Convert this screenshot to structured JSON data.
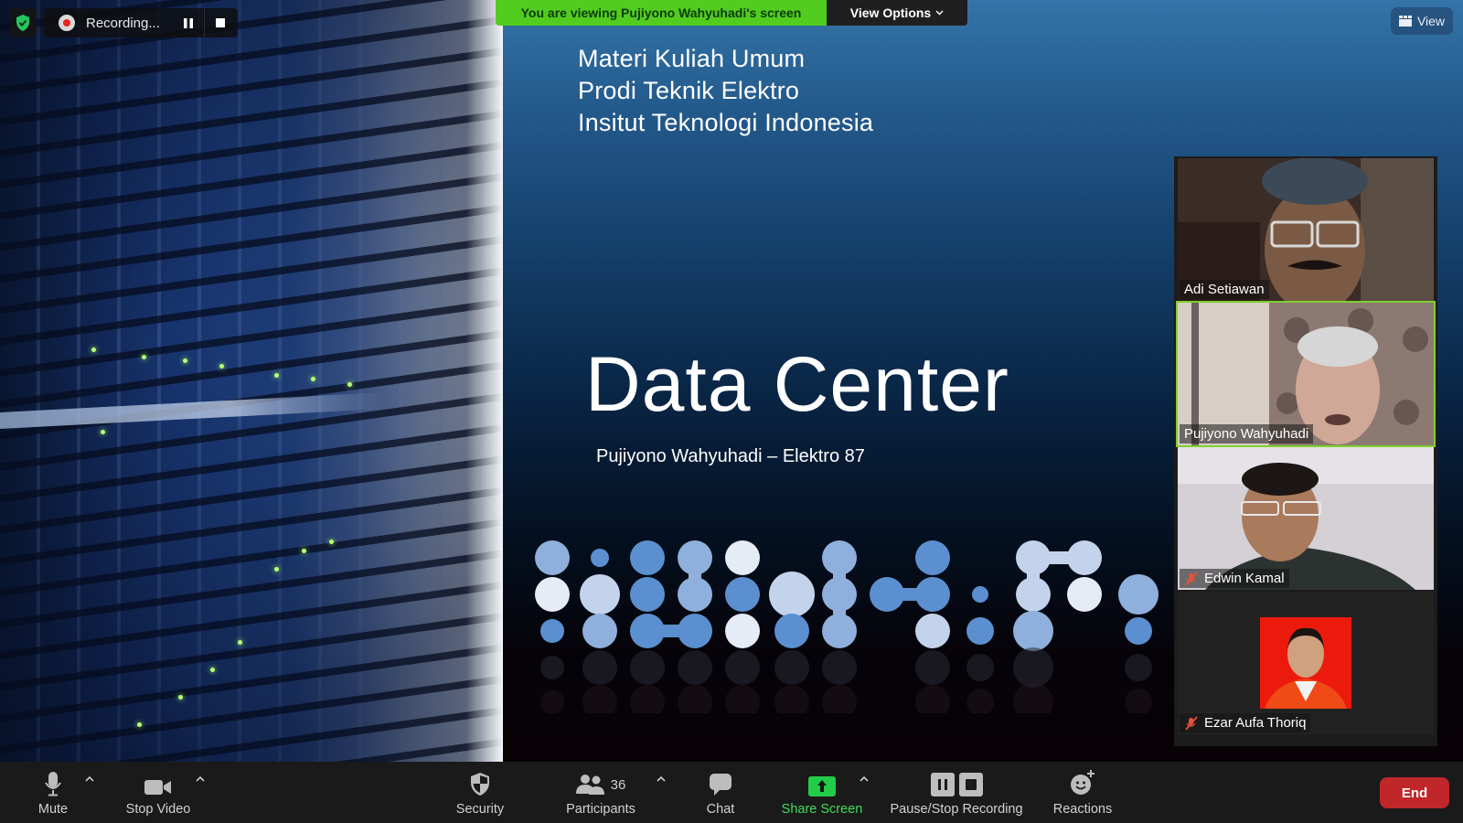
{
  "top_bar": {
    "recording_label": "Recording...",
    "viewing_banner": "You are viewing Pujiyono Wahyuhadi's screen",
    "view_options_label": "View Options",
    "view_button_label": "View"
  },
  "slide": {
    "headings": [
      "Materi Kuliah Umum",
      "Prodi Teknik Elektro",
      "Insitut Teknologi Indonesia"
    ],
    "title": "Data Center",
    "subtitle": "Pujiyono Wahyuhadi – Elektro 87"
  },
  "participants": [
    {
      "name": "Adi Setiawan",
      "muted": false,
      "active_speaker": false
    },
    {
      "name": "Pujiyono Wahyuhadi",
      "muted": false,
      "active_speaker": true
    },
    {
      "name": "Edwin Kamal",
      "muted": true,
      "active_speaker": false
    },
    {
      "name": "Ezar Aufa Thoriq",
      "muted": true,
      "active_speaker": false
    }
  ],
  "toolbar": {
    "mute_label": "Mute",
    "stop_video_label": "Stop Video",
    "security_label": "Security",
    "participants_label": "Participants",
    "participants_count": "36",
    "chat_label": "Chat",
    "share_screen_label": "Share Screen",
    "recording_label": "Pause/Stop Recording",
    "reactions_label": "Reactions",
    "end_label": "End"
  },
  "colors": {
    "banner_green": "#52cc1e",
    "share_green": "#3fdc58",
    "end_red": "#c0272a",
    "active_speaker_border": "#7fcf2e",
    "muted_red": "#e5533b"
  }
}
